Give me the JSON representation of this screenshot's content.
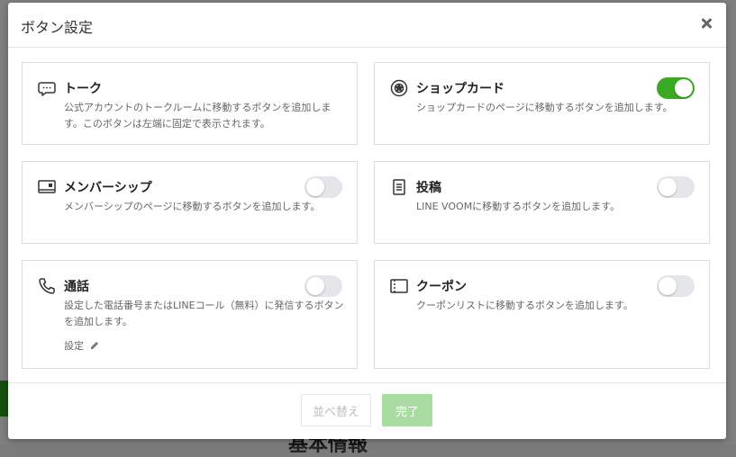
{
  "modal": {
    "title": "ボタン設定",
    "close_label": "×"
  },
  "cards": [
    {
      "id": "talk",
      "title": "トーク",
      "icon": "chat-bubble-icon",
      "description": "公式アカウントのトークルームに移動するボタンを追加します。このボタンは左端に固定で表示されます。",
      "has_toggle": false
    },
    {
      "id": "shopcard",
      "title": "ショップカード",
      "icon": "shop-card-icon",
      "description": "ショップカードのページに移動するボタンを追加します。",
      "has_toggle": true,
      "enabled": true
    },
    {
      "id": "membership",
      "title": "メンバーシップ",
      "icon": "membership-card-icon",
      "description": "メンバーシップのページに移動するボタンを追加します。",
      "has_toggle": true,
      "enabled": false
    },
    {
      "id": "post",
      "title": "投稿",
      "icon": "document-icon",
      "description": "LINE VOOMに移動するボタンを追加します。",
      "has_toggle": true,
      "enabled": false
    },
    {
      "id": "call",
      "title": "通話",
      "icon": "phone-icon",
      "description": "設定した電話番号またはLINEコール（無料）に発信するボタンを追加します。",
      "setting_label": "設定",
      "has_toggle": true,
      "enabled": false
    },
    {
      "id": "coupon",
      "title": "クーポン",
      "icon": "coupon-icon",
      "description": "クーポンリストに移動するボタンを追加します。",
      "has_toggle": true,
      "enabled": false
    }
  ],
  "footer": {
    "sort_label": "並べ替え",
    "done_label": "完了"
  },
  "background": {
    "heading_fragment": "基本情報"
  },
  "colors": {
    "toggle_on": "#3aaa24",
    "toggle_off": "#e4e6ea",
    "done_button_disabled": "#a8dca0"
  }
}
